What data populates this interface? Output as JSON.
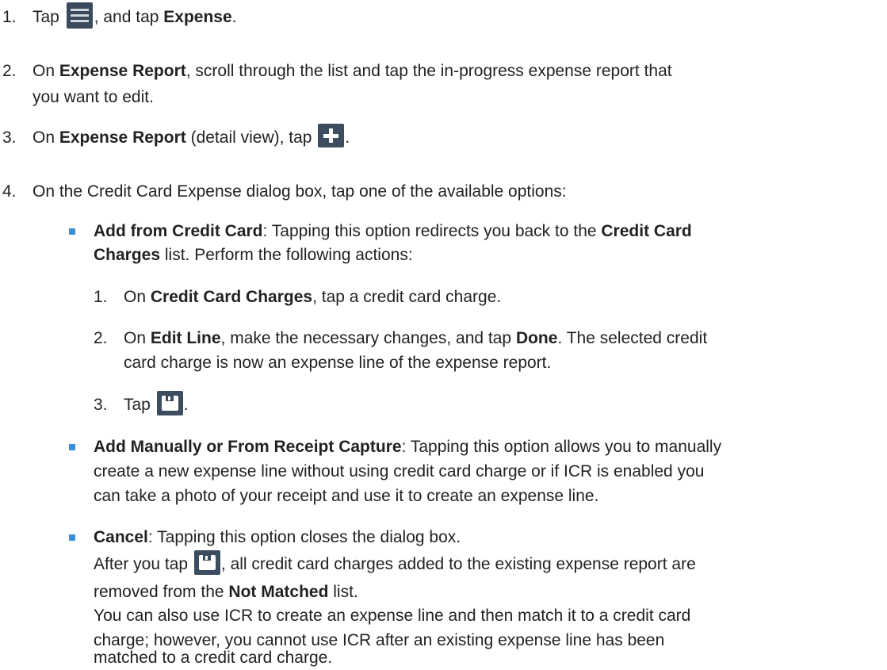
{
  "steps": [
    {
      "number": "1.",
      "pre": "Tap ",
      "icon": "menu-icon",
      "mid": ", and tap ",
      "bold": "Expense",
      "post": "."
    },
    {
      "number": "2.",
      "pre": "On ",
      "bold": "Expense Report",
      "line1_post": ", scroll through the list and tap the in-progress expense report that",
      "line2": "you want to edit."
    },
    {
      "number": "3.",
      "pre": "On ",
      "bold": "Expense Report",
      "mid": " (detail view), tap ",
      "icon": "plus-icon",
      "post": "."
    },
    {
      "number": "4.",
      "text": "On the Credit Card Expense dialog box, tap one of the available options:",
      "options": [
        {
          "title": "Add from Credit Card",
          "line1_mid": ": Tapping this option redirects you back to the ",
          "line1_bold": "Credit Card",
          "line2_bold": "Charges",
          "line2_post": " list. Perform the following actions:",
          "substeps": [
            {
              "number": "1.",
              "pre": "On ",
              "bold": "Credit Card Charges",
              "post": ", tap a credit card charge."
            },
            {
              "number": "2.",
              "pre": "On ",
              "bold": "Edit Line",
              "mid": ", make the necessary changes, and tap ",
              "bold2": "Done",
              "line1_post": ". The selected credit",
              "line2": "card charge is now an expense line of the expense report."
            },
            {
              "number": "3.",
              "pre": "Tap ",
              "icon": "save-icon",
              "post": "."
            }
          ]
        },
        {
          "title": "Add Manually or From Receipt Capture",
          "line1_post": ": Tapping this option allows you to manually",
          "line2": "create a new expense line without using credit card charge or if ICR is enabled you",
          "line3": "can take a photo of your receipt and use it to create an expense line."
        },
        {
          "title": "Cancel",
          "line1_post": ": Tapping this option closes the dialog box."
        }
      ]
    }
  ],
  "note_save": {
    "pre": "After you tap ",
    "icon": "save-icon",
    "line1_post": ", all credit card charges added to the existing expense report are",
    "line2_pre": "removed from the ",
    "line2_bold": "Not Matched",
    "line2_post": " list."
  },
  "note_icr": {
    "line1": "You can also use ICR to create an expense line and then match it to a credit card",
    "line2": "charge; however, you cannot use ICR after an existing expense line has been",
    "line3": "matched to a credit card charge."
  },
  "colors": {
    "text": "#222222",
    "bullet": "#3a8fd8",
    "icon_bg": "#3c4d5f"
  }
}
